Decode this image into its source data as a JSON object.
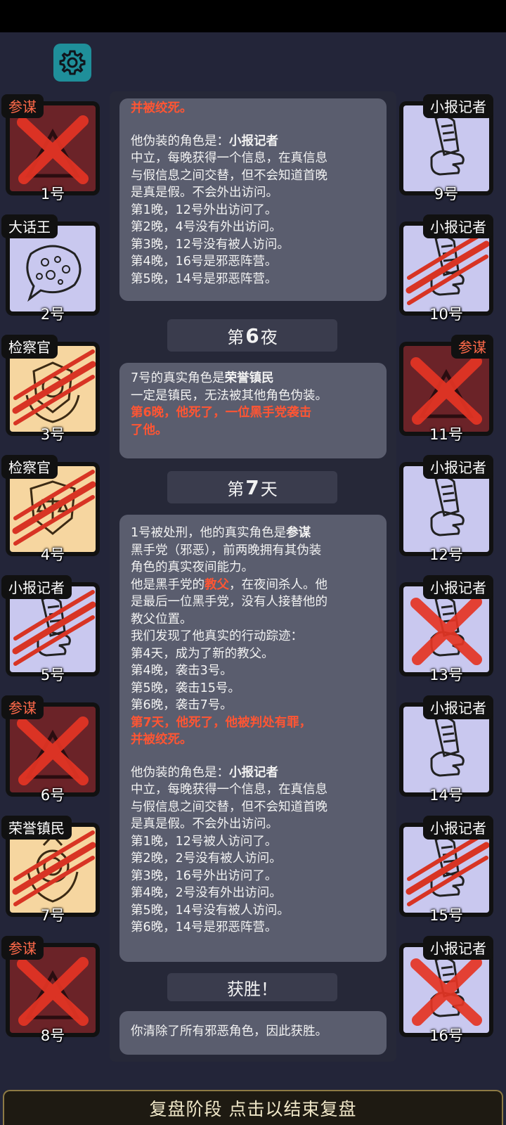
{
  "settings_icon": "gear-icon",
  "colors": {
    "accent": "#1f8f9a",
    "death": "#ff5533",
    "panel": "#5a5d6e",
    "evil_tag": "#ff6a4a"
  },
  "players_left": [
    {
      "role": "参谋",
      "number": "1号",
      "role_evil": true,
      "bg": "maroon",
      "icon": "triangle-icon",
      "status": "executed"
    },
    {
      "role": "大话王",
      "number": "2号",
      "role_evil": false,
      "bg": "lavender",
      "icon": "speech-bubble-icon",
      "status": "alive"
    },
    {
      "role": "检察官",
      "number": "3号",
      "role_evil": false,
      "bg": "tan",
      "icon": "badge-emblem-icon",
      "status": "killed"
    },
    {
      "role": "检察官",
      "number": "4号",
      "role_evil": false,
      "bg": "tan",
      "icon": "shield-scales-icon",
      "status": "killed"
    },
    {
      "role": "小报记者",
      "number": "5号",
      "role_evil": false,
      "bg": "lavender",
      "icon": "newspaper-hand-icon",
      "status": "killed"
    },
    {
      "role": "参谋",
      "number": "6号",
      "role_evil": true,
      "bg": "maroon",
      "icon": "triangle-icon",
      "status": "executed"
    },
    {
      "role": "荣誉镇民",
      "number": "7号",
      "role_evil": false,
      "bg": "tan",
      "icon": "medal-emblem-icon",
      "status": "killed"
    },
    {
      "role": "参谋",
      "number": "8号",
      "role_evil": true,
      "bg": "maroon",
      "icon": "triangle-icon",
      "status": "executed"
    }
  ],
  "players_right": [
    {
      "role": "小报记者",
      "number": "9号",
      "role_evil": false,
      "bg": "lavender",
      "icon": "newspaper-hand-icon",
      "status": "alive"
    },
    {
      "role": "小报记者",
      "number": "10号",
      "role_evil": false,
      "bg": "lavender",
      "icon": "newspaper-hand-icon",
      "status": "killed"
    },
    {
      "role": "参谋",
      "number": "11号",
      "role_evil": true,
      "bg": "maroon",
      "icon": "triangle-icon",
      "status": "executed"
    },
    {
      "role": "小报记者",
      "number": "12号",
      "role_evil": false,
      "bg": "lavender",
      "icon": "newspaper-hand-icon",
      "status": "alive"
    },
    {
      "role": "小报记者",
      "number": "13号",
      "role_evil": false,
      "bg": "lavender",
      "icon": "newspaper-hand-icon",
      "status": "executed"
    },
    {
      "role": "小报记者",
      "number": "14号",
      "role_evil": false,
      "bg": "lavender",
      "icon": "newspaper-hand-icon",
      "status": "alive"
    },
    {
      "role": "小报记者",
      "number": "15号",
      "role_evil": false,
      "bg": "lavender",
      "icon": "newspaper-hand-icon",
      "status": "killed"
    },
    {
      "role": "小报记者",
      "number": "16号",
      "role_evil": false,
      "bg": "lavender",
      "icon": "newspaper-hand-icon",
      "status": "executed"
    }
  ],
  "log": {
    "block1": {
      "top_cut": "并被绞死。",
      "disguise_prefix": "他伪装的角色是：",
      "disguise_role": "小报记者",
      "lines": [
        "中立，每晚获得一个信息，在真信息",
        "与假信息之间交替，但不会知道首晚",
        "是真是假。不会外出访问。",
        "第1晚，12号外出访问了。",
        "第2晚，4号没有外出访问。",
        "第3晚，12号没有被人访问。",
        "第4晚，16号是邪恶阵营。",
        "第5晚，14号是邪恶阵营。"
      ]
    },
    "phase_night6": {
      "prefix": "第",
      "num": "6",
      "suffix": "夜"
    },
    "block2": {
      "role_prefix": "7号的真实角色是",
      "role": "荣誉镇民",
      "desc": "一定是镇民，无法被其他角色伪装。",
      "death_1": "第6晚，他死了，一位黑手党袭击",
      "death_2": "了他。"
    },
    "phase_day7": {
      "prefix": "第",
      "num": "7",
      "suffix": "天"
    },
    "block3": {
      "exec_prefix": "1号被处刑，他的真实角色是",
      "exec_role": "参谋",
      "desc_lines": [
        "黑手党（邪恶），前两晚拥有其伪装",
        "角色的真实夜间能力。"
      ],
      "godfather_prefix": "他是黑手党的",
      "godfather_role": "教父",
      "godfather_suffix": "，在夜间杀人。他",
      "godfather_lines": [
        "是最后一位黑手党，没有人接替他的",
        "教父位置。",
        "我们发现了他真实的行动踪迹：",
        "第4天，成为了新的教父。",
        "第4晚，袭击3号。",
        "第5晚，袭击15号。",
        "第6晚，袭击7号。"
      ],
      "death_1": "第7天，他死了，他被判处有罪，",
      "death_2": "并被绞死。",
      "disguise_prefix": "他伪装的角色是：",
      "disguise_role": "小报记者",
      "lines": [
        "中立，每晚获得一个信息，在真信息",
        "与假信息之间交替，但不会知道首晚",
        "是真是假。不会外出访问。",
        "第1晚，12号被人访问了。",
        "第2晚，2号没有被人访问。",
        "第3晚，16号外出访问了。",
        "第4晚，2号没有外出访问。",
        "第5晚，14号没有被人访问。",
        "第6晚，14号是邪恶阵营。"
      ]
    },
    "phase_victory": {
      "label": "获胜！"
    },
    "block4": {
      "text": "你清除了所有邪恶角色，因此获胜。"
    }
  },
  "end_review_button": "复盘阶段 点击以结束复盘"
}
